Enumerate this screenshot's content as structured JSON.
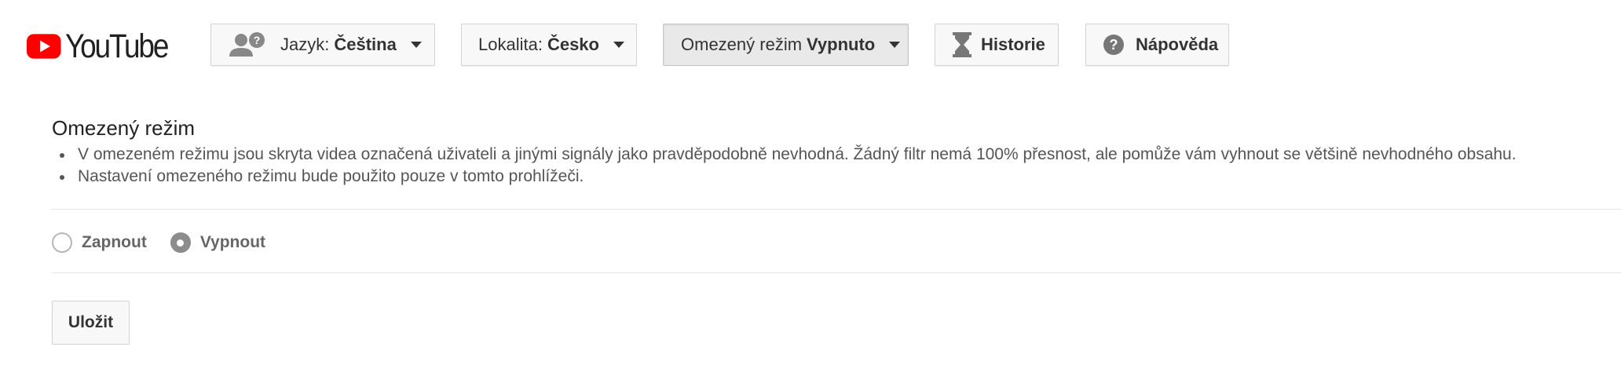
{
  "header": {
    "logo_text": "YouTube",
    "language_button": {
      "label": "Jazyk:",
      "value": "Čeština"
    },
    "location_button": {
      "label": "Lokalita:",
      "value": "Česko"
    },
    "restricted_button": {
      "label": "Omezený režim",
      "value": "Vypnuto"
    },
    "history_button": {
      "label": "Historie"
    },
    "help_button": {
      "label": "Nápověda"
    }
  },
  "restricted_mode": {
    "title": "Omezený režim",
    "bullets": [
      "V omezeném režimu jsou skryta videa označená uživateli a jinými signály jako pravděpodobně nevhodná. Žádný filtr nemá 100% přesnost, ale pomůže vám vyhnout se většině nevhodného obsahu.",
      "Nastavení omezeného režimu bude použito pouze v tomto prohlížeči."
    ],
    "options": [
      {
        "label": "Zapnout",
        "checked": false
      },
      {
        "label": "Vypnout",
        "checked": true
      }
    ],
    "save_label": "Uložit"
  },
  "colors": {
    "brand_red": "#ff0000",
    "button_bg": "#f8f8f8",
    "button_border": "#d3d3d3",
    "radio_checked": "#8c8c8c"
  },
  "icons": [
    "youtube-logo-icon",
    "language-people-icon",
    "chevron-down-icon",
    "hourglass-icon",
    "help-icon"
  ]
}
